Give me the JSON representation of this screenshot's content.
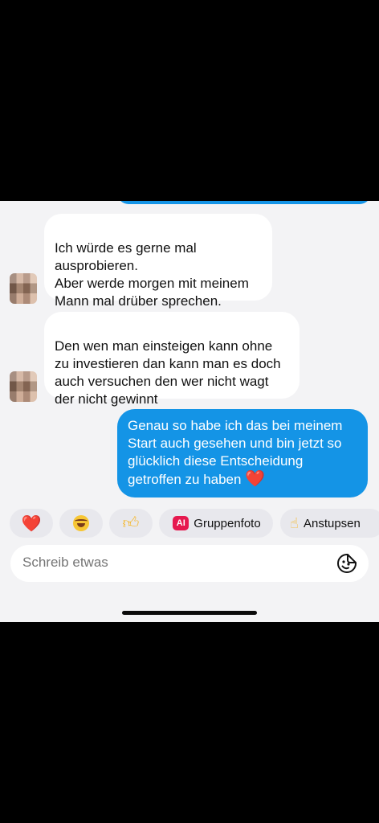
{
  "messages": [
    {
      "side": "incoming",
      "text": "Ich würde es gerne mal\nausprobieren.\nAber werde morgen mit meinem\nMann mal drüber sprechen."
    },
    {
      "side": "incoming",
      "text": "Den wen man einsteigen kann ohne\nzu investieren dan kann man es doch\nauch versuchen den wer nicht wagt\nder nicht gewinnt"
    },
    {
      "side": "outgoing",
      "text": "Genau so habe ich das bei meinem\nStart auch gesehen und bin jetzt so\nglücklich diese Entscheidung\ngetroffen zu haben",
      "emoji": "❤️"
    }
  ],
  "quick_actions": {
    "heart": "❤️",
    "laugh": "😂",
    "thumbs_up": "👍",
    "group_photo_badge": "AI",
    "group_photo_label": "Gruppenfoto",
    "poke_label": "Anstupsen"
  },
  "composer": {
    "placeholder": "Schreib etwas",
    "sticker_icon": "sticker-face-icon"
  },
  "colors": {
    "outgoing_bubble": "#1494e6",
    "incoming_bubble": "#ffffff",
    "background": "#f3f3f5",
    "chip": "#e8e8ed",
    "ai_badge": "#e6194f"
  }
}
